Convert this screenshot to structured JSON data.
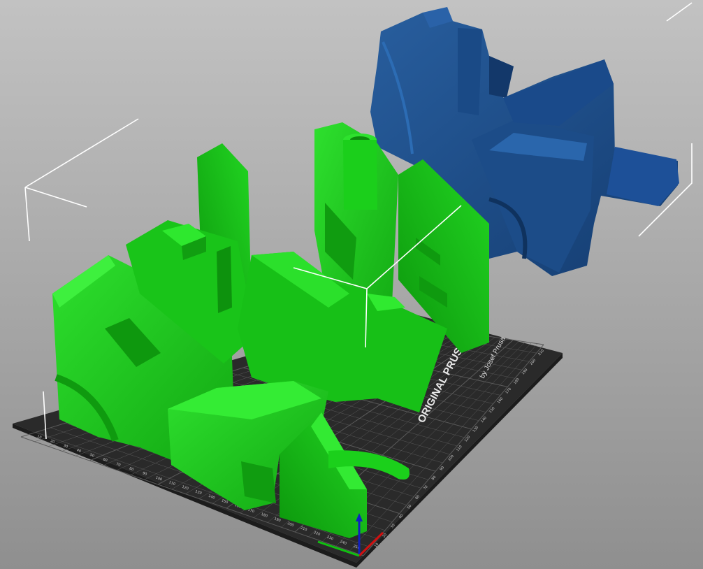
{
  "viewport": {
    "background_top": "#c2c2c2",
    "background_bottom": "#8f8f8f"
  },
  "bed": {
    "model_label": "ORIGINAL PRUSA i3  MK2",
    "maker_label": "by Josef Prusa",
    "plate_color": "#2a2a2a",
    "grid_color": "#5a5a5a",
    "ruler_ticks_y": [
      "10",
      "20",
      "30",
      "40",
      "50",
      "60",
      "70",
      "80",
      "90",
      "100",
      "110",
      "120",
      "130",
      "140",
      "150",
      "160",
      "170",
      "180",
      "190",
      "200",
      "210"
    ],
    "ruler_ticks_x": [
      "10",
      "20",
      "30",
      "40",
      "50",
      "60",
      "70",
      "80",
      "90",
      "100",
      "110",
      "120",
      "130",
      "140",
      "150",
      "160",
      "170",
      "180",
      "190",
      "200",
      "210",
      "220",
      "230",
      "240",
      "250"
    ]
  },
  "objects": [
    {
      "name": "green-print-object",
      "state": "selected",
      "color": "#1fcc1f"
    },
    {
      "name": "blue-print-object",
      "state": "unselected",
      "color": "#1f4f8f"
    }
  ],
  "axes": {
    "z_color": "#1020c0",
    "x_color": "#d01010",
    "y_color": "#10c010"
  }
}
